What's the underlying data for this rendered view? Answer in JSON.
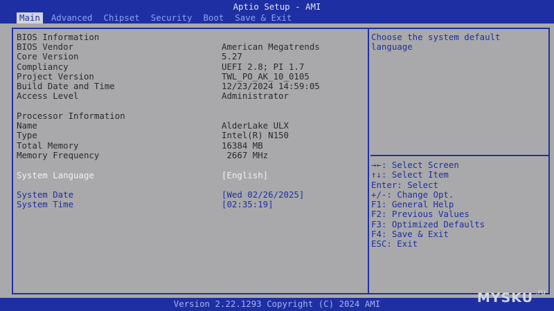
{
  "header": {
    "title": "Aptio Setup - AMI",
    "tabs": [
      "Main",
      "Advanced",
      "Chipset",
      "Security",
      "Boot",
      "Save & Exit"
    ],
    "active_tab": "Main"
  },
  "main": {
    "bios_section": "BIOS Information",
    "bios_rows": [
      {
        "label": "BIOS Vendor",
        "value": "American Megatrends"
      },
      {
        "label": "Core Version",
        "value": "5.27"
      },
      {
        "label": "Compliancy",
        "value": "UEFI 2.8; PI 1.7"
      },
      {
        "label": "Project Version",
        "value": "TWL_PO_AK_10_0105"
      },
      {
        "label": "Build Date and Time",
        "value": "12/23/2024 14:59:05"
      },
      {
        "label": "Access Level",
        "value": "Administrator"
      }
    ],
    "processor_section": "Processor Information",
    "processor_rows": [
      {
        "label": "Name",
        "value": "AlderLake ULX"
      },
      {
        "label": "Type",
        "value": "Intel(R) N150"
      },
      {
        "label": "Total Memory",
        "value": "16384 MB"
      },
      {
        "label": "Memory Frequency",
        "value": " 2667 MHz"
      }
    ],
    "language": {
      "label": "System Language",
      "value": "[English]"
    },
    "date": {
      "label": "System Date",
      "value": "[Wed 02/26/2025]"
    },
    "time": {
      "label": "System Time",
      "value": "[02:35:19]"
    }
  },
  "help": {
    "description_lines": [
      "Choose the system default",
      "language"
    ],
    "keys": [
      "→←: Select Screen",
      "↑↓: Select Item",
      "Enter: Select",
      "+/-: Change Opt.",
      "F1: General Help",
      "F2: Previous Values",
      "F3: Optimized Defaults",
      "F4: Save & Exit",
      "ESC: Exit"
    ]
  },
  "footer": {
    "text": "Version 2.22.1293 Copyright (C) 2024 AMI"
  },
  "watermark": {
    "text": "MYSKU",
    "suffix": ".ru"
  },
  "colors": {
    "frame": "#1e2fa3",
    "background": "#a9a9ab",
    "text": "#2a2a2a",
    "tab_text": "#8fa2ee",
    "active_tab_bg": "#d4d4d6"
  }
}
